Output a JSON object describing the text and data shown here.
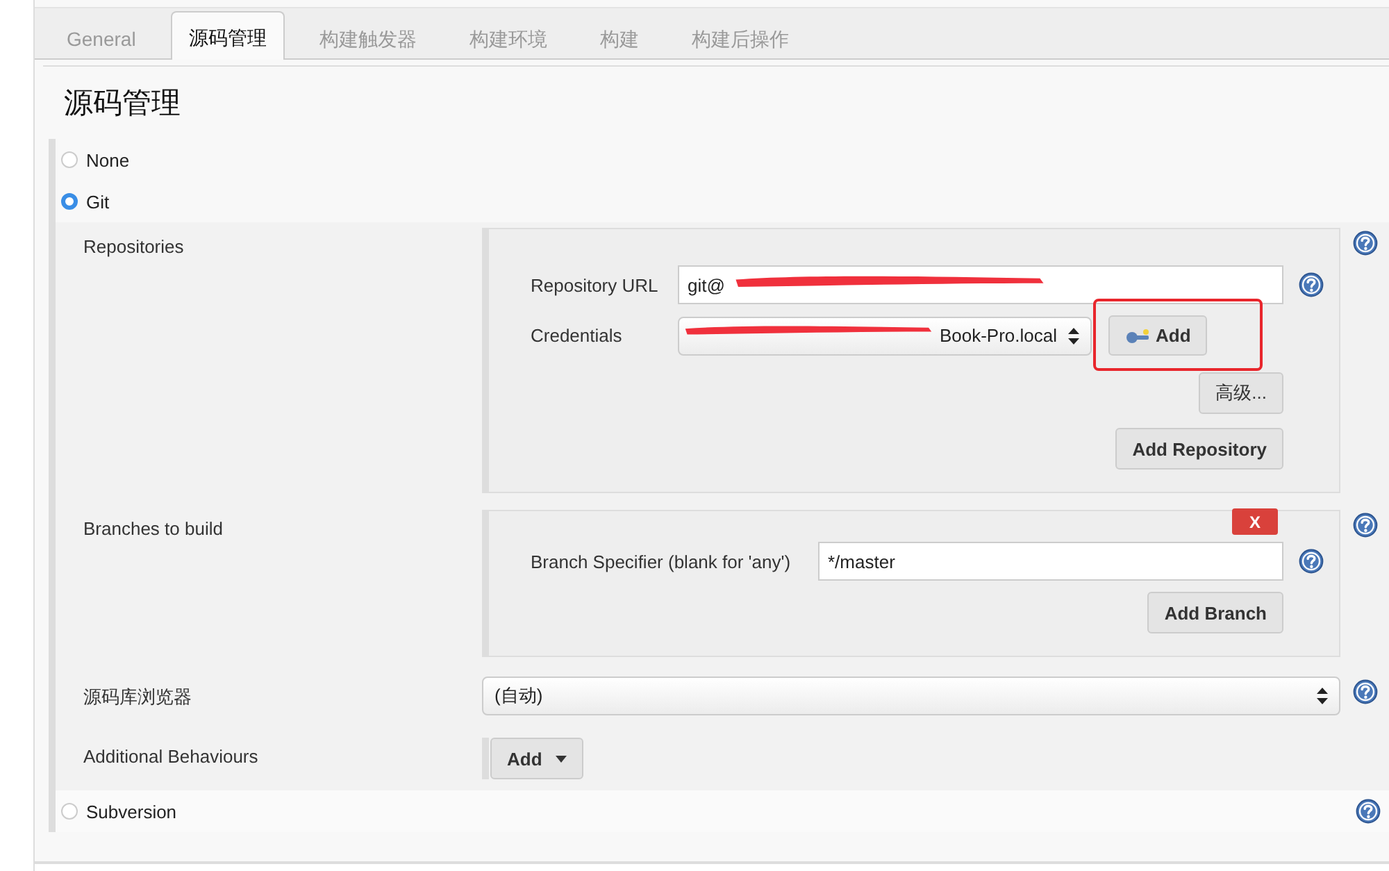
{
  "tabs": [
    {
      "label": "General",
      "selected": false
    },
    {
      "label": "源码管理",
      "selected": true
    },
    {
      "label": "构建触发器",
      "selected": false
    },
    {
      "label": "构建环境",
      "selected": false
    },
    {
      "label": "构建",
      "selected": false
    },
    {
      "label": "构建后操作",
      "selected": false
    }
  ],
  "section_title": "源码管理",
  "scm_options": [
    {
      "label": "None",
      "selected": false
    },
    {
      "label": "Git",
      "selected": true,
      "kind": "git",
      "config": {
        "repositories": {
          "label": "Repositories",
          "url_label": "Repository URL",
          "url_value": "git@",
          "credentials_label": "Credentials",
          "credentials_value": "Book-Pro.local",
          "add_button": "Add",
          "advanced_button": "高级...",
          "add_repository_button": "Add Repository"
        },
        "branches": {
          "label": "Branches to build",
          "delete_button": "X",
          "specifier_label": "Branch Specifier (blank for 'any')",
          "specifier_value": "*/master",
          "add_branch_button": "Add Branch"
        },
        "browser": {
          "label": "源码库浏览器",
          "value": "(自动)"
        },
        "behaviours": {
          "label": "Additional Behaviours",
          "add_button": "Add"
        }
      }
    },
    {
      "label": "Subversion",
      "selected": false,
      "kind": "plain"
    }
  ]
}
